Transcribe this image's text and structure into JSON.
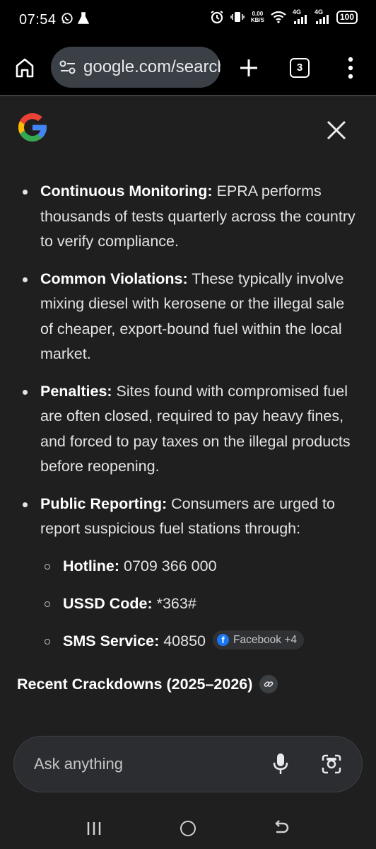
{
  "status_bar": {
    "time": "07:54",
    "data_speed_value": "0.00",
    "data_speed_unit": "KB/S",
    "network1": "4G",
    "network2": "4G",
    "battery": "100"
  },
  "toolbar": {
    "url": "google.com/search",
    "tab_count": "3"
  },
  "bullets": [
    {
      "title": "Continuous Monitoring:",
      "text": " EPRA performs thousands of tests quarterly across the country to verify compliance."
    },
    {
      "title": "Common Violations:",
      "text": " These typically involve mixing diesel with kerosene or the illegal sale of cheaper, export-bound fuel within the local market."
    },
    {
      "title": "Penalties:",
      "text": " Sites found with compromised fuel are often closed, required to pay heavy fines, and forced to pay taxes on the illegal products before reopening."
    },
    {
      "title": "Public Reporting:",
      "text": " Consumers are urged to report suspicious fuel stations through:"
    }
  ],
  "sub_bullets": [
    {
      "title": "Hotline:",
      "text": " 0709 366 000"
    },
    {
      "title": "USSD Code:",
      "text": " *363#"
    },
    {
      "title": "SMS Service:",
      "text": " 40850"
    }
  ],
  "source_chip": {
    "label": "Facebook +4",
    "icon": "facebook-icon"
  },
  "section_heading": "Recent Crackdowns (2025–2026)",
  "ask_bar": {
    "placeholder": "Ask anything"
  },
  "colors": {
    "background": "#1f1f1f",
    "surface": "#2c2d30",
    "url_bar": "#3b3f46",
    "facebook": "#1877f2"
  }
}
